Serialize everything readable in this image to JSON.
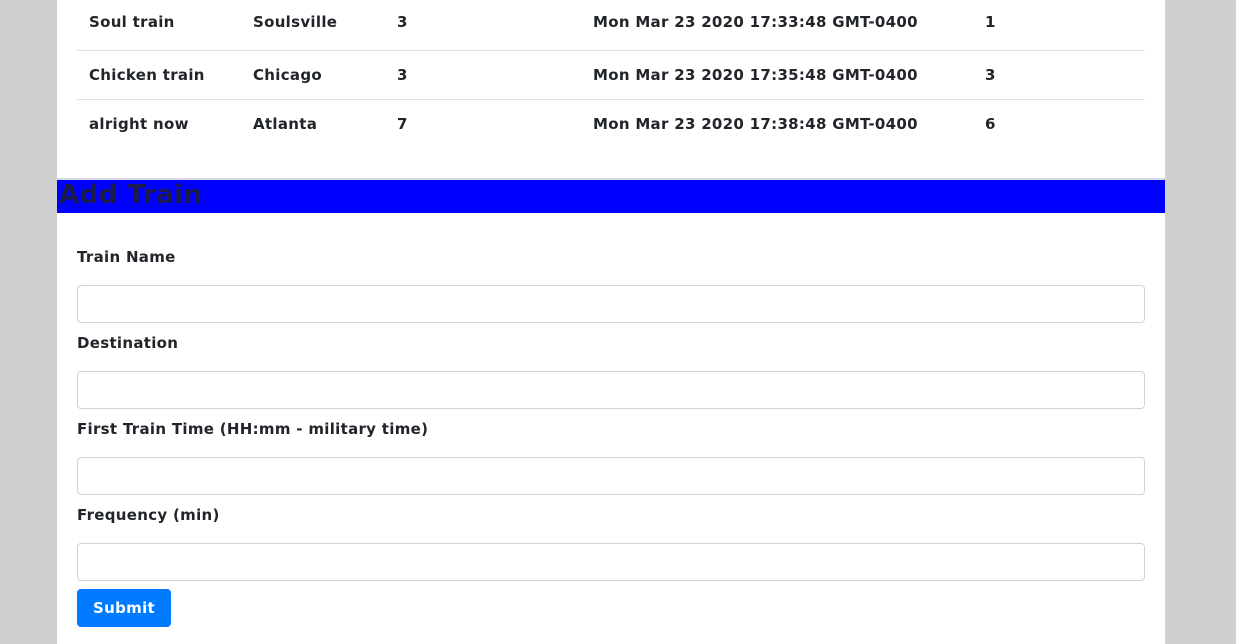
{
  "schedule": {
    "rows": [
      {
        "name": "Soul train",
        "destination": "Soulsville",
        "frequency": "3",
        "next_arrival": "Mon Mar 23 2020 17:33:48 GMT-0400",
        "minutes_away": "1"
      },
      {
        "name": "Chicken train",
        "destination": "Chicago",
        "frequency": "3",
        "next_arrival": "Mon Mar 23 2020 17:35:48 GMT-0400",
        "minutes_away": "3"
      },
      {
        "name": "alright now",
        "destination": "Atlanta",
        "frequency": "7",
        "next_arrival": "Mon Mar 23 2020 17:38:48 GMT-0400",
        "minutes_away": "6"
      }
    ]
  },
  "add_train": {
    "title": "Add Train",
    "fields": [
      {
        "label": "Train Name",
        "value": "",
        "placeholder": ""
      },
      {
        "label": "Destination",
        "value": "",
        "placeholder": ""
      },
      {
        "label": "First Train Time (HH:mm - military time)",
        "value": "",
        "placeholder": ""
      },
      {
        "label": "Frequency (min)",
        "value": "",
        "placeholder": ""
      }
    ],
    "submit_label": "Submit"
  },
  "colors": {
    "page_background": "#cfcfcf",
    "header_bar": "#0000ff",
    "submit_button": "#007bff"
  }
}
